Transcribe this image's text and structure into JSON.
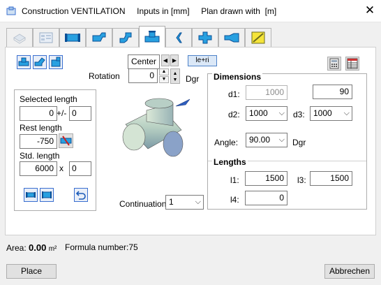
{
  "window": {
    "title": "Construction VENTILATION",
    "inputs_unit": "Inputs in [mm]",
    "plan_unit": "Plan drawn with  [m]"
  },
  "tabs": [
    {
      "icon": "ghost-duct-icon"
    },
    {
      "icon": "form-icon"
    },
    {
      "icon": "straight-duct-icon"
    },
    {
      "icon": "bend-icon"
    },
    {
      "icon": "bend-offset-icon"
    },
    {
      "icon": "tee-icon"
    },
    {
      "icon": "saddle-icon"
    },
    {
      "icon": "cross-icon"
    },
    {
      "icon": "reducer-icon"
    },
    {
      "icon": "damper-icon"
    }
  ],
  "panel": {
    "orientation": {
      "value": "Center",
      "le_ri_label": "le+ri"
    },
    "rotation": {
      "label": "Rotation",
      "value": "0",
      "unit": "Dgr"
    },
    "left_group": {
      "selected_length_label": "Selected length",
      "selected_length_value": "0",
      "plusminus": "+/-",
      "tolerance_value": "0",
      "rest_length_label": "Rest length",
      "rest_length_value": "-750",
      "std_length_label": "Std. length",
      "std_length_value": "6000",
      "times": "x",
      "count_value": "0"
    },
    "continuation": {
      "label": "Continuation",
      "value": "1"
    },
    "dimensions": {
      "heading": "Dimensions",
      "d1_label": "d1:",
      "d1_value": "1000",
      "extra_value": "90",
      "d2_label": "d2:",
      "d2_value": "1000",
      "d3_label": "d3:",
      "d3_value": "1000",
      "angle_label": "Angle:",
      "angle_value": "90.00",
      "angle_unit": "Dgr"
    },
    "lengths": {
      "heading": "Lengths",
      "l1_label": "l1:",
      "l1_value": "1500",
      "l3_label": "l3:",
      "l3_value": "1500",
      "l4_label": "l4:",
      "l4_value": "0"
    }
  },
  "status": {
    "area_label": "Area:",
    "area_value": "0.00",
    "area_unit": "m²",
    "formula": "Formula number:75"
  },
  "buttons": {
    "place": "Place",
    "cancel": "Abbrechen"
  }
}
